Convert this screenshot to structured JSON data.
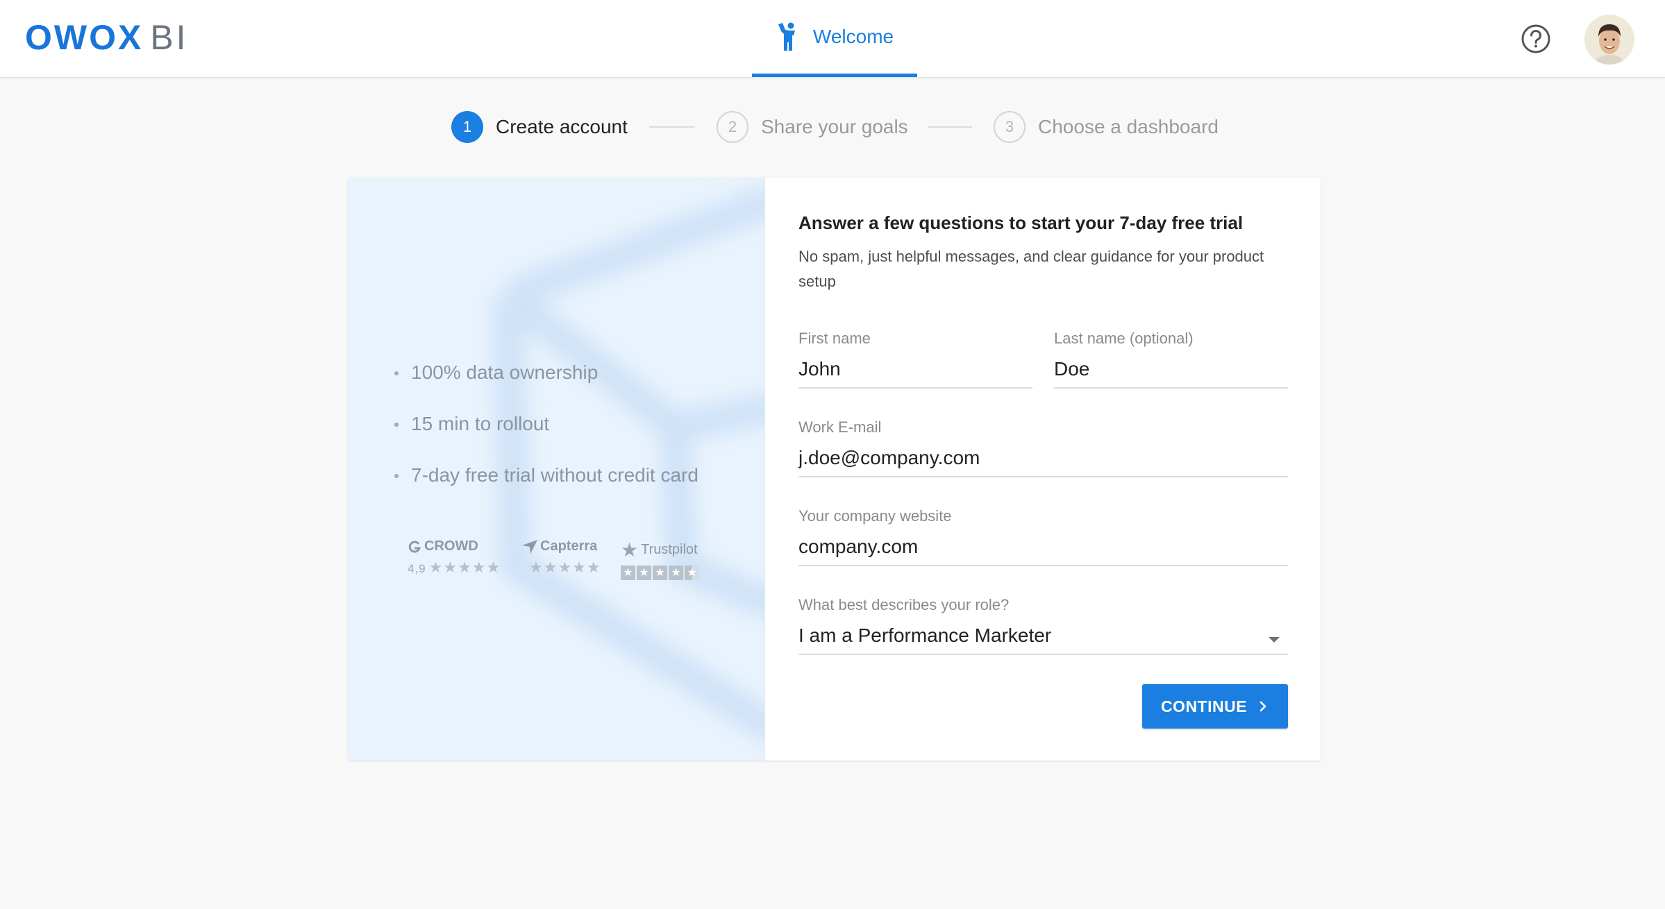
{
  "header": {
    "logo_main": "OWOX",
    "logo_suffix": "BI",
    "nav_tab": "Welcome"
  },
  "stepper": {
    "steps": [
      {
        "number": "1",
        "label": "Create account",
        "active": true
      },
      {
        "number": "2",
        "label": "Share your goals",
        "active": false
      },
      {
        "number": "3",
        "label": "Choose a dashboard",
        "active": false
      }
    ]
  },
  "benefits": [
    "100% data ownership",
    "15 min to rollout",
    "7-day free trial without credit card"
  ],
  "ratings": {
    "g2": {
      "name": "CROWD",
      "score": "4,9",
      "stars": "★★★★★"
    },
    "capterra": {
      "name": "Capterra",
      "stars": "★★★★★"
    },
    "trustpilot": {
      "name": "Trustpilot"
    }
  },
  "form": {
    "title": "Answer a few questions to start your 7-day free trial",
    "subtitle": "No spam, just helpful messages, and clear guidance for your product setup",
    "first_name": {
      "label": "First name",
      "value": "John"
    },
    "last_name": {
      "label": "Last name (optional)",
      "value": "Doe"
    },
    "email": {
      "label": "Work E-mail",
      "value": "j.doe@company.com"
    },
    "website": {
      "label": "Your company website",
      "value": "company.com"
    },
    "role": {
      "label": "What best describes your role?",
      "value": "I am a Performance Marketer"
    },
    "continue_label": "CONTINUE"
  },
  "colors": {
    "accent": "#1a7fe0",
    "logo_blue": "#1a75d8",
    "left_panel_bg": "#e9f3fd"
  },
  "icons": {
    "nav_tab": "person-waving-icon",
    "help": "question-circle-icon",
    "continue": "chevron-right-icon"
  }
}
